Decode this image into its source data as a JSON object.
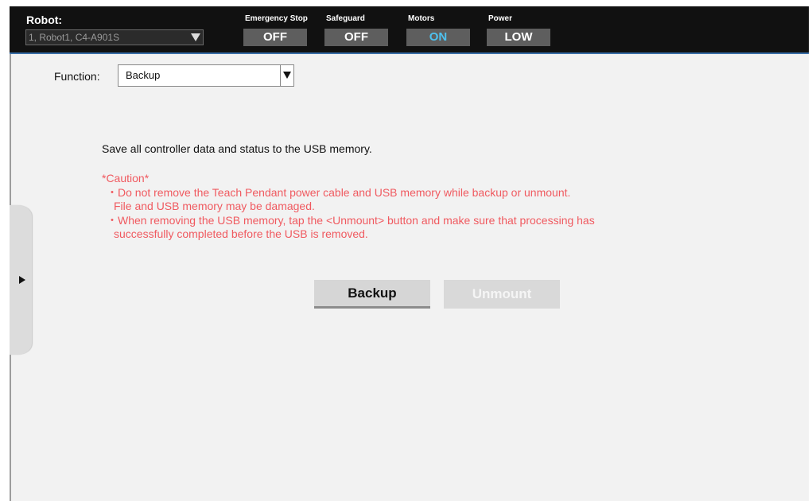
{
  "topbar": {
    "robot_label": "Robot:",
    "robot_value": "1, Robot1, C4-A901S",
    "statuses": [
      {
        "label": "Emergency Stop",
        "value": "OFF"
      },
      {
        "label": "Safeguard",
        "value": "OFF"
      },
      {
        "label": "Motors",
        "value": "ON"
      },
      {
        "label": "Power",
        "value": "LOW"
      }
    ],
    "colors": {
      "bar_bg": "#111111",
      "status_bg": "#5e5e5e",
      "on_color": "#4ec1ee",
      "accent_line": "#3a6fa8"
    }
  },
  "function": {
    "label": "Function:",
    "selected": "Backup"
  },
  "main": {
    "description": "Save all controller data and status to the USB memory.",
    "caution_title": "*Caution*",
    "caution_items": [
      {
        "line1": "・Do not remove the Teach Pendant power cable and USB memory while backup or unmount.",
        "line2": "File and USB memory may be damaged."
      },
      {
        "line1": "・When removing the USB memory, tap the <Unmount> button and make sure that processing has",
        "line2": "successfully completed before the USB is removed."
      }
    ],
    "caution_color": "#f05a60"
  },
  "buttons": {
    "backup": "Backup",
    "unmount": "Unmount"
  },
  "side_tab": {
    "icon": "triangle-right-icon"
  }
}
